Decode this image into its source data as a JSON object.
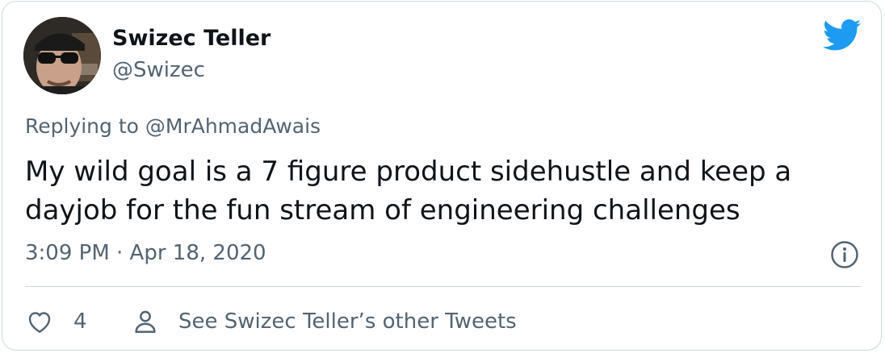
{
  "author": {
    "name": "Swizec Teller",
    "handle": "@Swizec"
  },
  "reply": {
    "prefix": "Replying to ",
    "to": "@MrAhmadAwais"
  },
  "tweet": {
    "text": "My wild goal is a 7 figure product sidehustle and keep a dayjob for the fun stream of engineering challenges",
    "timestamp": "3:09 PM · Apr 18, 2020"
  },
  "actions": {
    "like_count": "4",
    "other_tweets_label": "See Swizec Teller’s other Tweets"
  },
  "colors": {
    "twitter_blue": "#1d9bf0",
    "secondary_text": "#536471",
    "primary_text": "#0f1419",
    "border": "#cfd9de"
  },
  "icons": {
    "brand": "twitter-bird-icon",
    "info": "info-icon",
    "like": "heart-icon",
    "profile": "person-icon"
  }
}
